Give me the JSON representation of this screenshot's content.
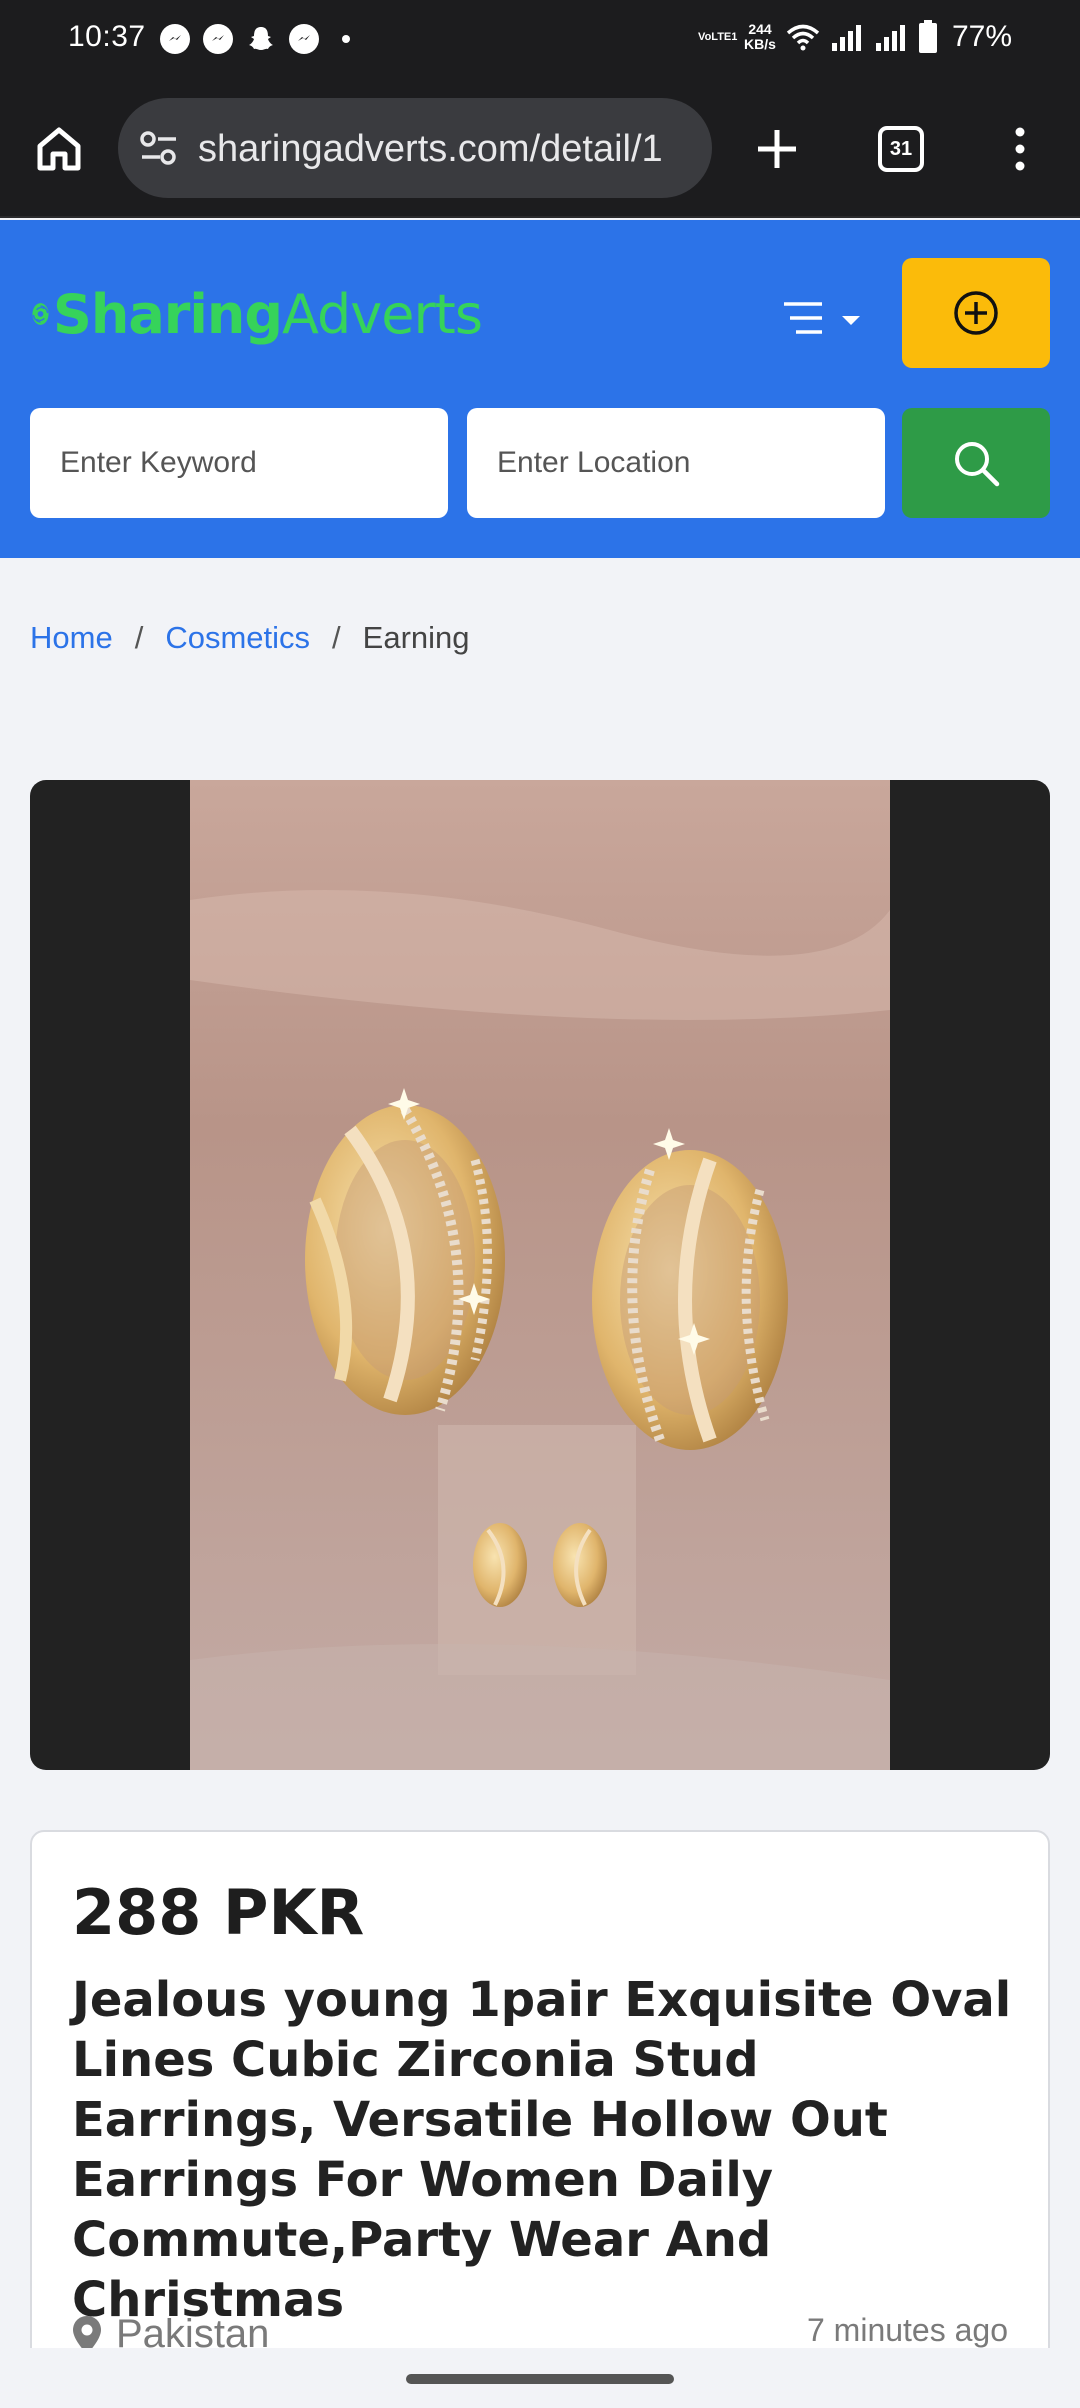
{
  "status_bar": {
    "time": "10:37",
    "network_label": "VoLTE1",
    "speed_value": "244",
    "speed_unit": "KB/s",
    "battery": "77%",
    "notification_icons": [
      "messenger-icon",
      "messenger-icon",
      "snapchat-icon",
      "messenger-icon"
    ]
  },
  "browser": {
    "url": "sharingadverts.com/detail/1",
    "tab_count": "31"
  },
  "header": {
    "brand_bold": "Sharing",
    "brand_light": "Adverts",
    "keyword_placeholder": "Enter Keyword",
    "location_placeholder": "Enter Location",
    "colors": {
      "header_bg": "#2c73e8",
      "post_button": "#fbbb0a",
      "search_button": "#2e9b47",
      "logo_green": "#36d35a"
    }
  },
  "breadcrumb": {
    "home": "Home",
    "category": "Cosmetics",
    "current": "Earning",
    "separator": "/"
  },
  "listing": {
    "price": "288 PKR",
    "title": "Jealous young 1pair Exquisite Oval Lines Cubic Zirconia Stud Earrings, Versatile Hollow Out Earrings For Women Daily Commute,Party Wear And Christmas",
    "location": "Pakistan",
    "posted": "7 minutes ago"
  }
}
